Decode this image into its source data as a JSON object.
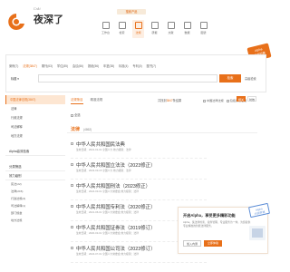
{
  "brand": {
    "sub": "Cnki",
    "title": "夜深了"
  },
  "header": {
    "badge": "搜索产品",
    "links": [
      "个人中心",
      "消息",
      "帮助",
      "登录"
    ]
  },
  "nav": [
    {
      "label": "工作台",
      "icon": "desk-icon"
    },
    {
      "label": "检索",
      "icon": "search-icon"
    },
    {
      "label": "法规",
      "icon": "law-icon"
    },
    {
      "label": "研报",
      "icon": "report-icon"
    },
    {
      "label": "文献",
      "icon": "doc-icon"
    },
    {
      "label": "数据",
      "icon": "data-icon"
    },
    {
      "label": "图谱",
      "icon": "graph-icon"
    }
  ],
  "float_tag": {
    "line1": "Alpha",
    "line2": "内测招募"
  },
  "filters": [
    "案例(7)",
    "法规(3847)",
    "期刊(63)",
    "学位(85)",
    "会议(66)",
    "报纸(56)",
    "年鉴(38)",
    "标准(4)",
    "专利(0)",
    "图书(7)",
    "成果(0)"
  ],
  "search": {
    "field": "标题 ▾",
    "placeholder": "",
    "button": "检索",
    "adv": "高级检索"
  },
  "sidebar": {
    "head": "中国法律法规(3847)",
    "items": [
      "法律",
      "行政法规",
      "司法解释",
      "地方法规"
    ],
    "section2": "Alpha高效检索",
    "section3": "分类筛选",
    "section4": "效力级别",
    "subs": [
      "宪法(22)",
      "法律(215)",
      "行政法规(3)",
      "司法解释(1)",
      "部门规章",
      "地方法规"
    ]
  },
  "main": {
    "tabs": [
      "法规条目",
      "精准法规"
    ],
    "result_prefix": "共找到",
    "result_num": "3847",
    "result_suffix": "条结果",
    "check1": "中国法律法规",
    "check2": "包括失效法规",
    "sort1": "相关",
    "sort2": "时效",
    "select_all": "全选",
    "cat_title": "法律",
    "cat_count": "(4862)",
    "results": [
      {
        "title": "中华人民共和国民法典",
        "meta": "生效日期：2021-01-01  全国人大  效力级别：法律"
      },
      {
        "title": "中华人民共和国立法法（2023修正）",
        "meta": "生效日期：2023-03-15  全国人大  效力级别：法律"
      },
      {
        "title": "中华人民共和国刑法（2023修正）",
        "meta": "生效日期：2024-03-01  全国人大常委会  效力级别：法律"
      },
      {
        "title": "中华人民共和国专利法（2020修正）",
        "meta": "生效日期：2021-06-01  全国人大常委会  效力级别：法律"
      },
      {
        "title": "中华人民共和国证券法（2019修订）",
        "meta": "生效日期：2020-03-01  全国人大常委会  效力级别：法律"
      },
      {
        "title": "中华人民共和国公司法（2023修订）",
        "meta": "生效日期：2024-07-01  全国人大常委会  效力级别：法律"
      }
    ]
  },
  "promo": {
    "title": "开启Alpha，享受更多精彩功能",
    "desc": "Alpha，集法律检索、案件管理、专业服务为一体，为您提供专业精准的智能法律服务。",
    "btn1": "加入内测",
    "btn2": "立即体验",
    "close": "×",
    "side_tag_line1": "Alpha",
    "side_tag_line2": "内测开放"
  },
  "colors": {
    "accent": "#e8701a",
    "accent_light": "#fdeee2"
  }
}
